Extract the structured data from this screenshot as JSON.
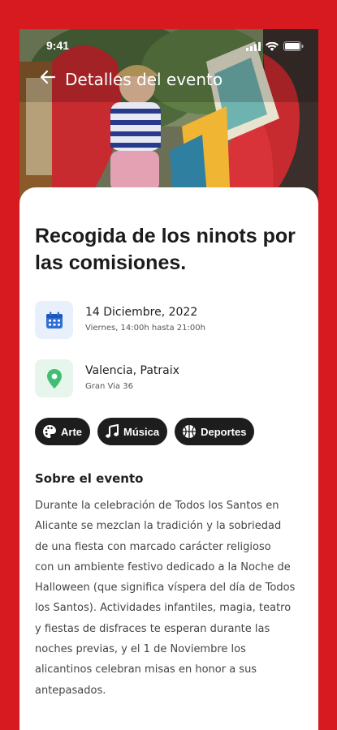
{
  "status_bar": {
    "time": "9:41"
  },
  "nav": {
    "title": "Detalles del evento",
    "back_icon": "arrow-left-icon"
  },
  "event": {
    "title": "Recogida de los ninots por las comisiones.",
    "date": {
      "icon": "calendar-icon",
      "main": "14 Diciembre, 2022",
      "sub": "Viernes, 14:00h hasta 21:00h"
    },
    "location": {
      "icon": "location-pin-icon",
      "main": "Valencia, Patraix",
      "sub": "Gran Via 36"
    }
  },
  "categories": [
    {
      "label": "Arte",
      "icon": "palette-icon"
    },
    {
      "label": "Música",
      "icon": "music-note-icon"
    },
    {
      "label": "Deportes",
      "icon": "basketball-icon"
    }
  ],
  "about": {
    "title": "Sobre el evento",
    "lines": [
      "Durante la celebración de Todos los Santos en",
      "Alicante se mezclan la tradición y la sobriedad",
      "de una fiesta con marcado carácter religioso",
      "con un ambiente festivo dedicado a la Noche de",
      "Halloween (que significa víspera del día de Todos",
      "los Santos). Actividades infantiles, magia, teatro",
      "y fiestas de disfraces te esperan durante las",
      "noches previas, y el 1 de Noviembre los",
      "alicantinos celebran misas en honor a sus",
      "antepasados."
    ]
  },
  "colors": {
    "brand_red": "#d71920",
    "chip_bg": "#1d1d1d",
    "calendar_blue": "#2f6fd6",
    "pin_green": "#3fbf73"
  }
}
